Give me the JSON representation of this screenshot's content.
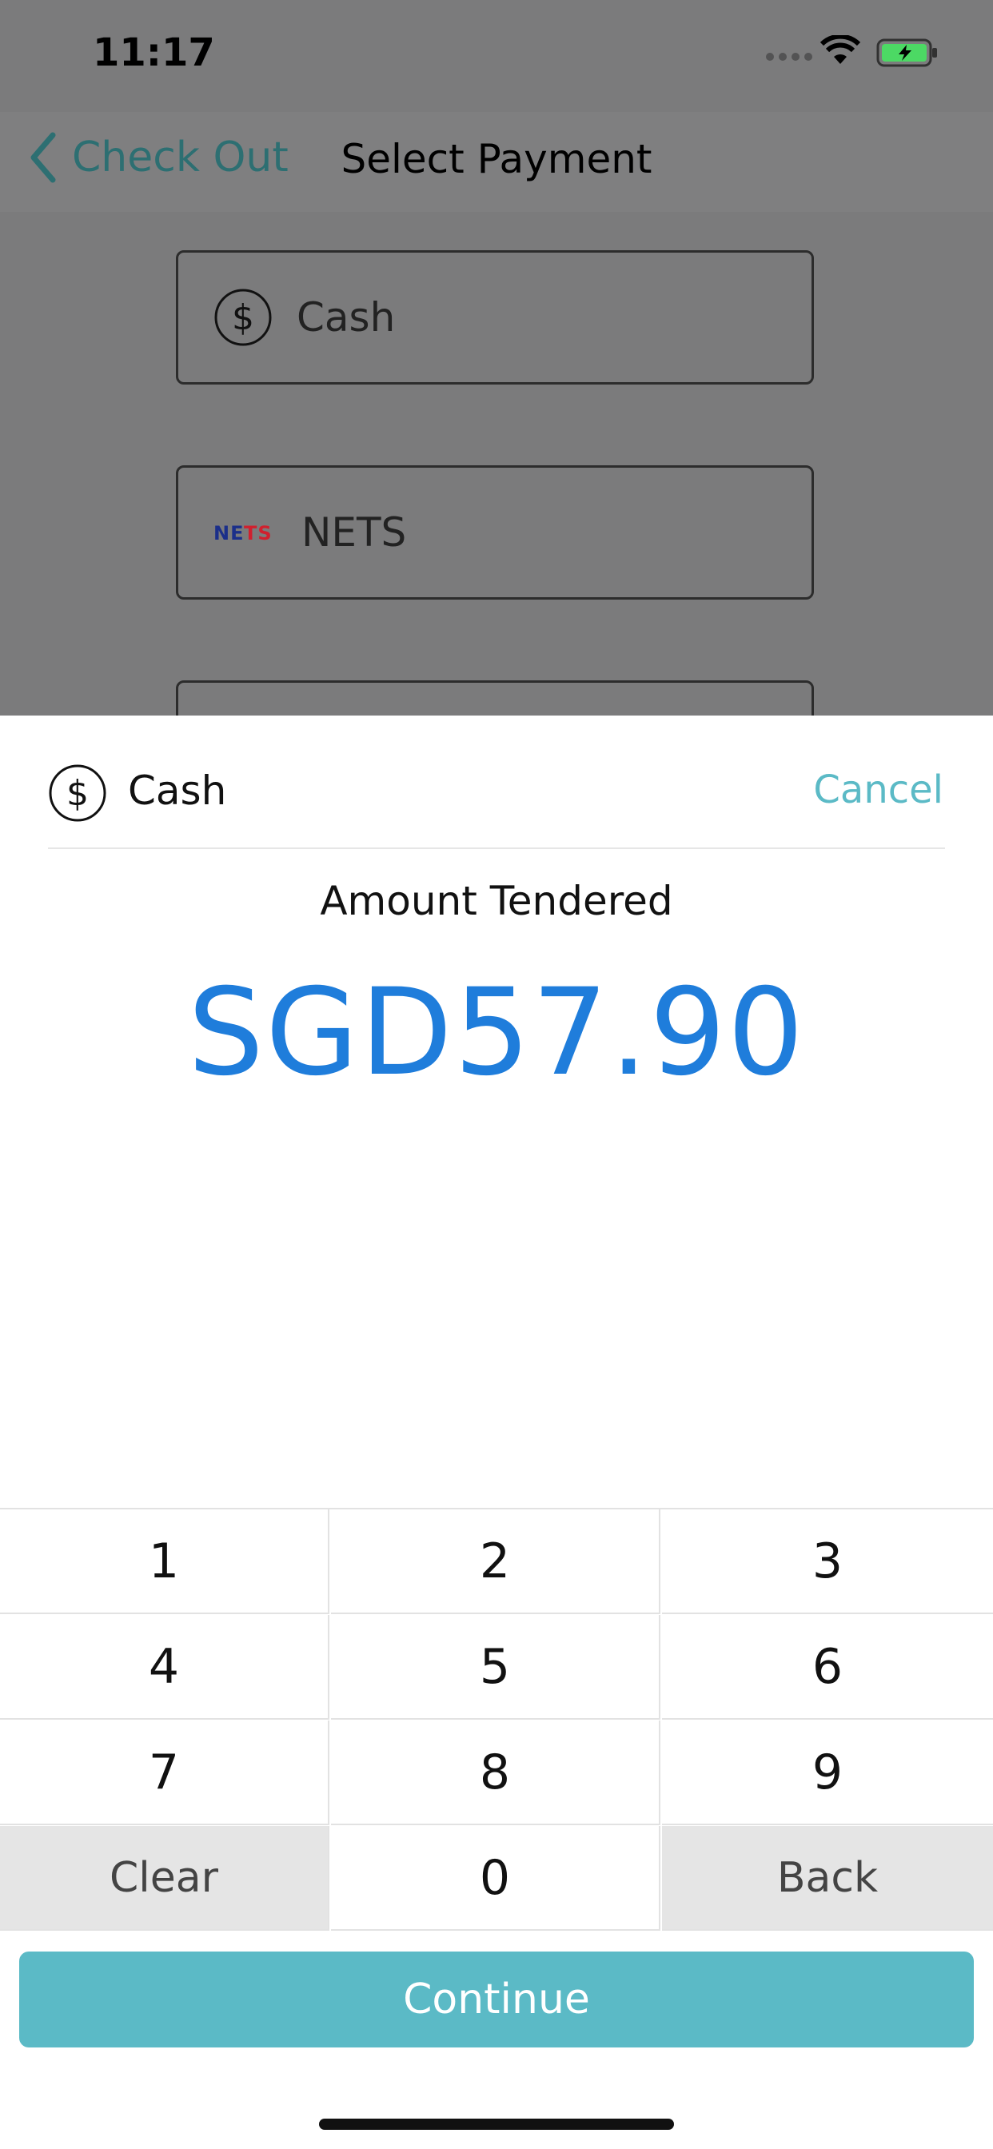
{
  "status_bar": {
    "time": "11:17"
  },
  "navbar": {
    "back_label": "Check Out",
    "title": "Select Payment"
  },
  "payment_options": [
    {
      "label": "Cash",
      "icon": "dollar-circle-icon"
    },
    {
      "label": "NETS",
      "icon": "nets-logo"
    }
  ],
  "sheet": {
    "method_label": "Cash",
    "method_icon": "dollar-circle-icon",
    "cancel_label": "Cancel",
    "amount_label": "Amount Tendered",
    "amount_value": "SGD57.90"
  },
  "keypad": {
    "keys": [
      "1",
      "2",
      "3",
      "4",
      "5",
      "6",
      "7",
      "8",
      "9",
      "Clear",
      "0",
      "Back"
    ]
  },
  "continue_label": "Continue",
  "colors": {
    "accent": "#5bbac6",
    "amount": "#1f7ddb",
    "back_link": "#2d6f72",
    "battery": "#4cd964"
  }
}
